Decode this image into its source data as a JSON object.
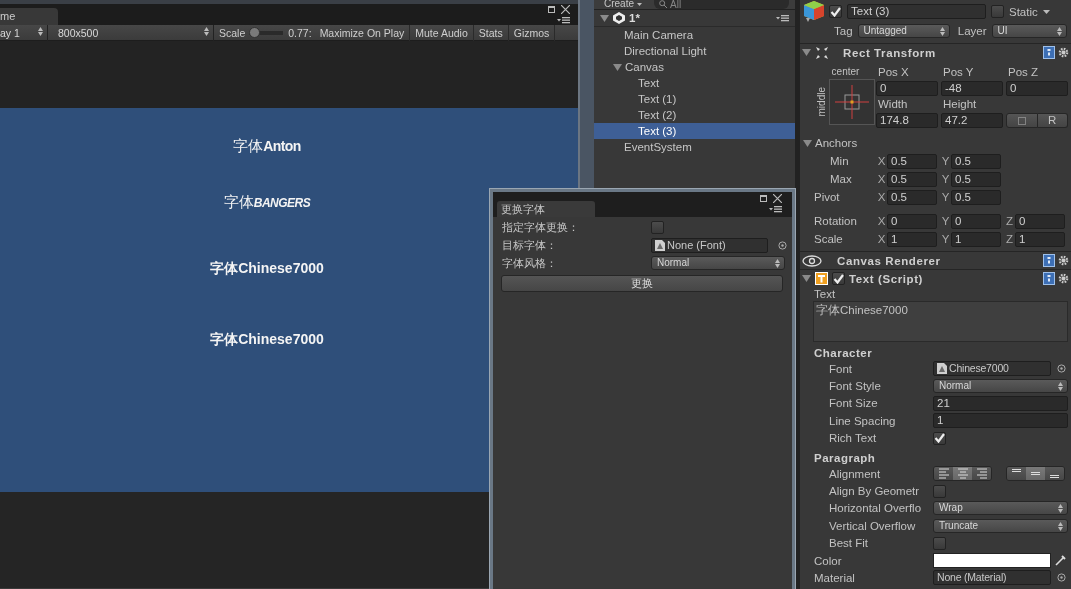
{
  "game_view": {
    "tab": "me",
    "display": "ay 1",
    "resolution": "800x500",
    "scale": {
      "label": "Scale",
      "level": 0.0,
      "reading": "0.77:"
    },
    "toggles": [
      {
        "label": "Maximize On Play",
        "on": false
      },
      {
        "label": "Mute Audio",
        "on": false
      },
      {
        "label": "Stats",
        "on": false
      },
      {
        "label": "Gizmos",
        "on": false
      }
    ],
    "texts": [
      {
        "prefix": "字体",
        "name": "Anton",
        "kind": "condensed"
      },
      {
        "prefix": "字体",
        "name": "BANGERS",
        "kind": "comic"
      },
      {
        "prefix": "字体",
        "name": "Chinese7000",
        "kind": "rounded"
      },
      {
        "prefix": "字体",
        "name": "Chinese7000",
        "kind": "rounded"
      }
    ]
  },
  "hierarchy": {
    "create": "Create",
    "search_placeholder": "All",
    "scene": {
      "label": "1*",
      "expanded": true
    },
    "items": [
      {
        "label": "Main Camera",
        "selected": false
      },
      {
        "label": "Directional Light",
        "selected": false
      },
      {
        "label": "Canvas",
        "selected": false,
        "expanded": true,
        "children": [
          {
            "label": "Text",
            "selected": false
          },
          {
            "label": "Text (1)",
            "selected": false
          },
          {
            "label": "Text (2)",
            "selected": false
          },
          {
            "label": "Text (3)",
            "selected": true
          }
        ]
      },
      {
        "label": "EventSystem",
        "selected": false
      }
    ]
  },
  "inspector": {
    "active": true,
    "name": "Text (3)",
    "static": {
      "label": "Static",
      "checked": false
    },
    "tag": {
      "label": "Tag",
      "value": "Untagged"
    },
    "layer": {
      "label": "Layer",
      "value": "UI"
    },
    "rect_transform": {
      "title": "Rect Transform",
      "expanded": true,
      "anchor_preset": {
        "horizontal": "center",
        "vertical": "middle"
      },
      "fields": [
        {
          "label": "Pos X",
          "value": "0"
        },
        {
          "label": "Pos Y",
          "value": "-48"
        },
        {
          "label": "Pos Z",
          "value": "0"
        },
        {
          "label": "Width",
          "value": "174.8"
        },
        {
          "label": "Height",
          "value": "47.2"
        }
      ],
      "raw_button": "R",
      "anchors": {
        "label": "Anchors",
        "expanded": true,
        "rows": [
          {
            "label": "Min",
            "axes": [
              {
                "axis": "X",
                "value": "0.5"
              },
              {
                "axis": "Y",
                "value": "0.5"
              }
            ]
          },
          {
            "label": "Max",
            "axes": [
              {
                "axis": "X",
                "value": "0.5"
              },
              {
                "axis": "Y",
                "value": "0.5"
              }
            ]
          }
        ]
      },
      "pivot": {
        "label": "Pivot",
        "axes": [
          {
            "axis": "X",
            "value": "0.5"
          },
          {
            "axis": "Y",
            "value": "0.5"
          }
        ]
      },
      "transform_rows": [
        {
          "label": "Rotation",
          "axes": [
            {
              "axis": "X",
              "value": "0"
            },
            {
              "axis": "Y",
              "value": "0"
            },
            {
              "axis": "Z",
              "value": "0"
            }
          ]
        },
        {
          "label": "Scale",
          "axes": [
            {
              "axis": "X",
              "value": "1"
            },
            {
              "axis": "Y",
              "value": "1"
            },
            {
              "axis": "Z",
              "value": "1"
            }
          ]
        }
      ]
    },
    "canvas_renderer": {
      "title": "Canvas Renderer"
    },
    "text_script": {
      "title": "Text (Script)",
      "expanded": true,
      "enabled": true,
      "text_label": "Text",
      "text_value": "字体Chinese7000",
      "groups": [
        {
          "title": "Character",
          "rows": [
            {
              "kind": "asset",
              "label": "Font",
              "value": "Chinese7000"
            },
            {
              "kind": "dropdown",
              "label": "Font Style",
              "value": "Normal"
            },
            {
              "kind": "field",
              "label": "Font Size",
              "value": "21"
            },
            {
              "kind": "field",
              "label": "Line Spacing",
              "value": "1"
            },
            {
              "kind": "checkbox",
              "label": "Rich Text",
              "checked": true
            }
          ]
        },
        {
          "title": "Paragraph",
          "rows": [
            {
              "kind": "alignment",
              "label": "Alignment",
              "horizontal": [
                {
                  "selected": false
                },
                {
                  "selected": true
                },
                {
                  "selected": false
                }
              ],
              "vertical": [
                {
                  "selected": false
                },
                {
                  "selected": true
                },
                {
                  "selected": false
                }
              ]
            },
            {
              "kind": "checkbox",
              "label": "Align By Geometr",
              "checked": false
            },
            {
              "kind": "dropdown",
              "label": "Horizontal Overflo",
              "value": "Wrap"
            },
            {
              "kind": "dropdown",
              "label": "Vertical Overflow",
              "value": "Truncate"
            },
            {
              "kind": "checkbox",
              "label": "Best Fit",
              "checked": false
            }
          ]
        }
      ],
      "rows": [
        {
          "kind": "color",
          "label": "Color",
          "color": "#ffffff"
        },
        {
          "kind": "object",
          "label": "Material",
          "value": "None (Material)"
        }
      ]
    }
  },
  "font_window": {
    "tab": "更换字体",
    "rows": [
      {
        "kind": "checkbox",
        "label": "指定字体更换：",
        "checked": false
      },
      {
        "kind": "asset",
        "label": "目标字体：",
        "value": "None (Font)"
      },
      {
        "kind": "dropdown",
        "label": "字体风格：",
        "value": "Normal"
      }
    ],
    "button": "更换"
  }
}
